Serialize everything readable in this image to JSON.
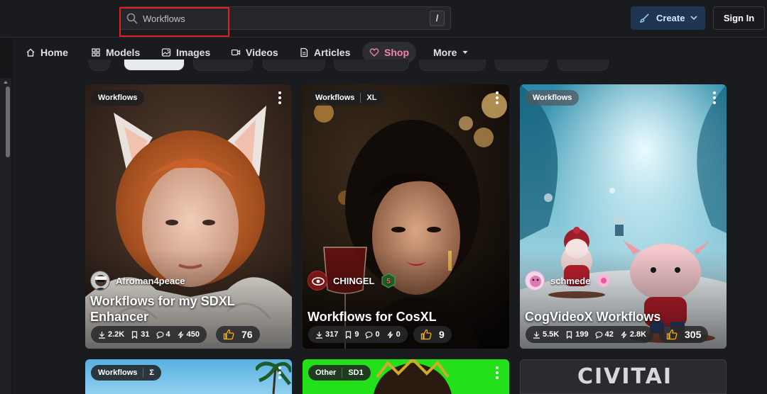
{
  "header": {
    "search": {
      "value": "Workflows",
      "shortcut": "/"
    },
    "create_label": "Create",
    "signin_label": "Sign In"
  },
  "nav": {
    "items": [
      {
        "label": "Home",
        "icon": "home-icon"
      },
      {
        "label": "Models",
        "icon": "grid-icon"
      },
      {
        "label": "Images",
        "icon": "image-icon"
      },
      {
        "label": "Videos",
        "icon": "video-icon"
      },
      {
        "label": "Articles",
        "icon": "article-icon"
      },
      {
        "label": "Shop",
        "icon": "heart-icon"
      },
      {
        "label": "More",
        "icon": "caret-down-icon"
      }
    ]
  },
  "colors": {
    "accent_pink": "#f783ac",
    "create_bg": "#1f3551",
    "highlight_red": "#e01f1f",
    "like_icon": "#fab005"
  },
  "cards": [
    {
      "badges": [
        "Workflows"
      ],
      "author": "Afroman4peace",
      "title": "Workflows for my SDXL Enhancer",
      "stats": {
        "downloads": "2.2K",
        "collected": "31",
        "comments": "4",
        "buzz": "450"
      },
      "likes": "76"
    },
    {
      "badges": [
        "Workflows",
        "XL"
      ],
      "author": "CHINGEL",
      "author_badge": "5",
      "title": "Workflows for CosXL",
      "stats": {
        "downloads": "317",
        "collected": "9",
        "comments": "0",
        "buzz": "0"
      },
      "likes": "9"
    },
    {
      "badges": [
        "Workflows"
      ],
      "author": "schmede",
      "title": "CogVideoX Workflows",
      "stats": {
        "downloads": "5.5K",
        "collected": "199",
        "comments": "42",
        "buzz": "2.8K"
      },
      "likes": "305"
    }
  ],
  "row2": [
    {
      "badges": [
        "Workflows",
        "Σ"
      ]
    },
    {
      "badges": [
        "Other",
        "SD1"
      ]
    },
    {
      "logo": "CIVITAI"
    }
  ]
}
